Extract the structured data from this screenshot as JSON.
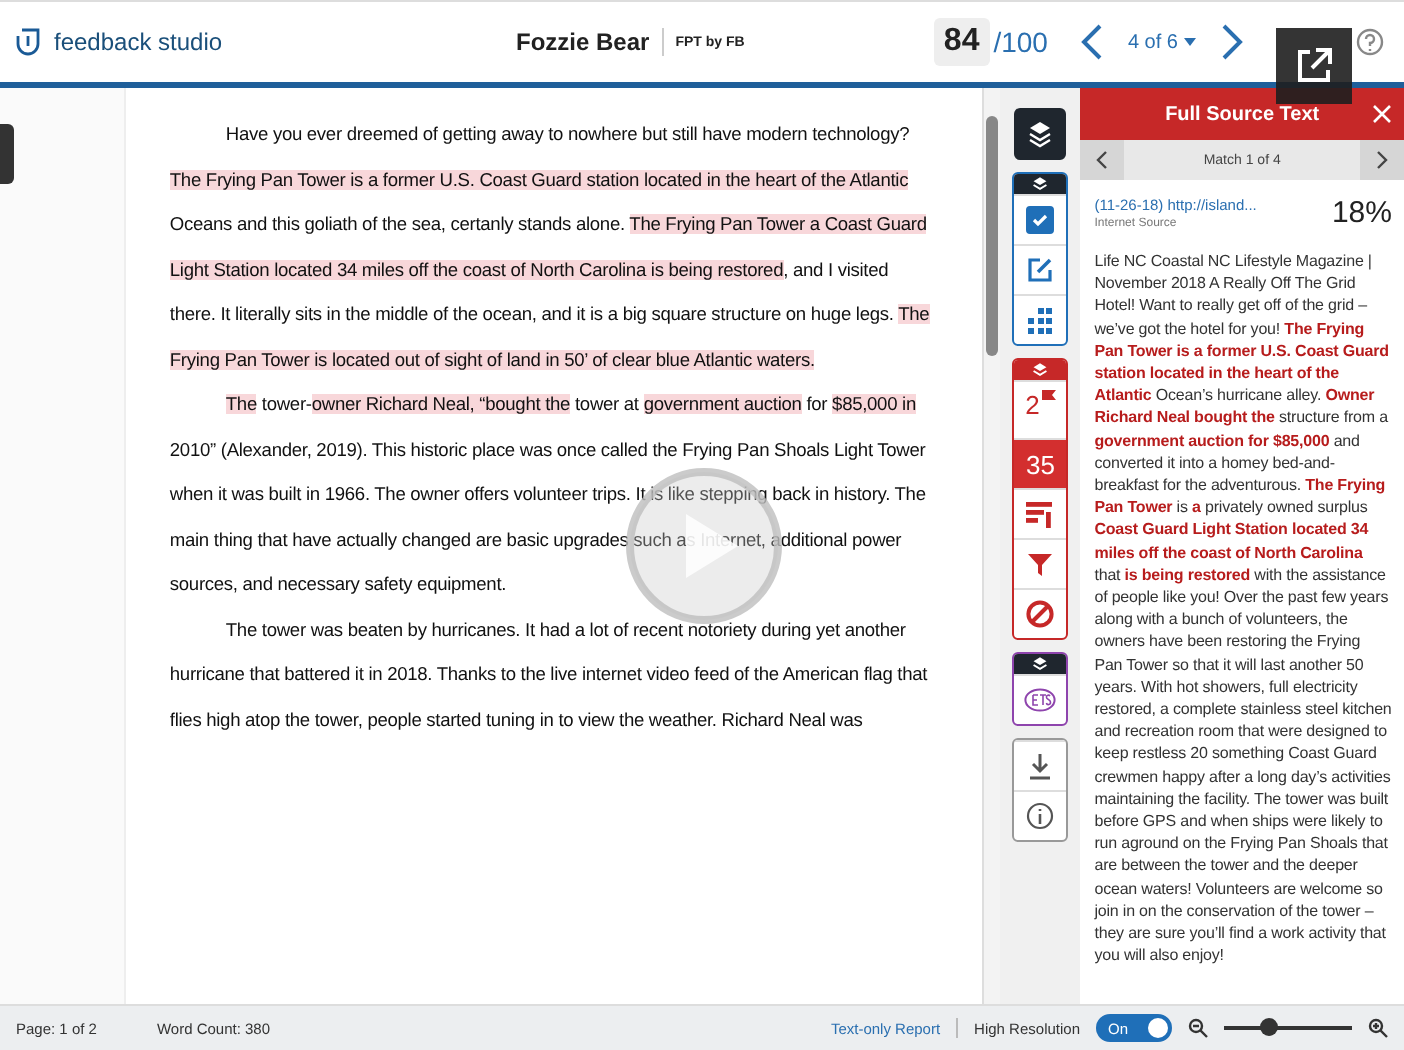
{
  "header": {
    "logo_text": "feedback studio",
    "student_name": "Fozzie Bear",
    "assignment": "FPT by FB",
    "score": "84",
    "score_max": "/100",
    "pager": "4 of 6"
  },
  "document": {
    "paragraphs": [
      {
        "indent": true,
        "segments": [
          {
            "text": "Have you ever dreemed of getting away to nowhere but still have modern technology? ",
            "highlighted": false
          },
          {
            "text": "The Frying Pan Tower is a former U.S. Coast Guard station located in the heart of the Atlantic",
            "highlighted": true
          },
          {
            "text": " Oceans and this goliath of the sea, certanly stands alone. ",
            "highlighted": false
          },
          {
            "text": "The Frying Pan Tower a Coast Guard Light Station located 34 miles off the coast of North Carolina is being restored",
            "highlighted": true
          },
          {
            "text": ", and I visited there. It literally sits in the middle of the ocean, and it is a big square structure on huge legs. ",
            "highlighted": false
          },
          {
            "text": "The Frying Pan Tower is located out of sight of land in 50’ of clear blue Atlantic waters.",
            "highlighted": true
          }
        ]
      },
      {
        "indent": true,
        "segments": [
          {
            "text": "The",
            "highlighted": true
          },
          {
            "text": " tower-",
            "highlighted": false
          },
          {
            "text": "owner Richard Neal, “bought the",
            "highlighted": true
          },
          {
            "text": " tower at ",
            "highlighted": false
          },
          {
            "text": "government auction",
            "highlighted": true
          },
          {
            "text": " for ",
            "highlighted": false
          },
          {
            "text": "$85,000 in",
            "highlighted": true
          },
          {
            "text": " 2010” (Alexander, 2019). This historic place was once called the Frying Pan Shoals Light Tower when it was built in 1966. The owner offers volunteer trips. It is like stepping back in history. The main thing that have actually changed are basic upgrades such as Internet, additional power sources, and necessary safety equipment.",
            "highlighted": false
          }
        ]
      },
      {
        "indent": true,
        "segments": [
          {
            "text": "The tower was beaten by hurricanes. It had a lot of recent notoriety during yet another hurricane that battered it in 2018. Thanks to the live internet video feed of the American flag that flies high atop the tower, people started tuning in to view the weather. Richard Neal was",
            "highlighted": false
          }
        ]
      }
    ]
  },
  "toolbar": {
    "grading_checked": true,
    "flag_count": "2",
    "match_count": "35"
  },
  "panel": {
    "title": "Full Source Text",
    "match_label": "Match 1 of 4",
    "source_title": "(11-26-18) http://island...",
    "source_type": "Internet Source",
    "percent": "18%",
    "text": "Life NC Coastal NC Lifestyle Magazine | November 2018 A Really Off The Grid Hotel! Want to really get off of the grid – we’ve got the hotel for you! **The Frying Pan Tower is a former U.S. Coast Guard station located in the heart of the Atlantic** Ocean’s hurricane alley. **Owner Richard Neal bought the** structure from a **government auction for $85,000** and converted it into a homey bed-and-breakfast for the adventurous. **The Frying Pan Tower** is **a** privately owned surplus **Coast Guard Light Station located 34 miles off the coast of North Carolina** that **is being restored** with the assistance of people like you! Over the past few years along with a bunch of volunteers, the owners have been restoring the Frying Pan Tower so that it will last another 50 years. With hot showers, full electricity restored, a complete stainless steel kitchen and recreation room that were designed to keep restless 20 something Coast Guard crewmen happy after a long day’s activities maintaining the facility. The tower was built before GPS and when ships were likely to run aground on the Frying Pan Shoals that are between the tower and the deeper ocean waters! Volunteers are welcome so join in on the conservation of the tower – they are sure you’ll find a work activity that you will also enjoy!"
  },
  "status_bar": {
    "page": "Page: 1 of 2",
    "word_count": "Word Count: 380",
    "report_link": "Text-only Report",
    "high_res_label": "High Resolution",
    "toggle": {
      "on": true,
      "label": "On"
    },
    "zoom": {
      "level": 0.35
    }
  }
}
